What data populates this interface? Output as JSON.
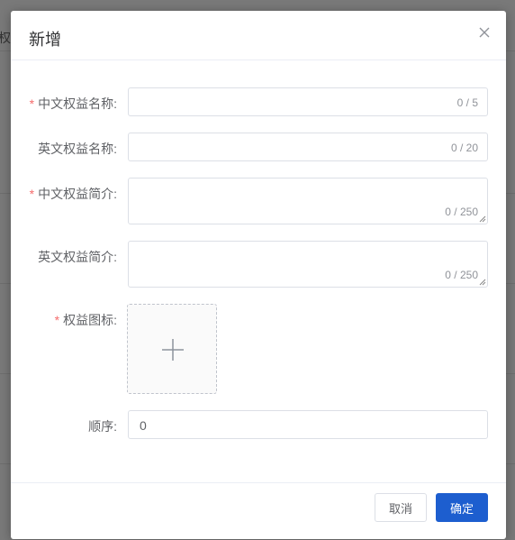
{
  "background": {
    "fragment_text": "权"
  },
  "dialog": {
    "title": "新增",
    "fields": {
      "cn_name": {
        "label": "中文权益名称:",
        "required": true,
        "counter": "0 / 5"
      },
      "en_name": {
        "label": "英文权益名称:",
        "required": false,
        "counter": "0 / 20"
      },
      "cn_intro": {
        "label": "中文权益简介:",
        "required": true,
        "counter": "0 / 250"
      },
      "en_intro": {
        "label": "英文权益简介:",
        "required": false,
        "counter": "0 / 250"
      },
      "icon": {
        "label": "权益图标:",
        "required": true
      },
      "order": {
        "label": "顺序:",
        "value": "0"
      }
    },
    "required_mark": "*",
    "footer": {
      "cancel_label": "取消",
      "ok_label": "确定"
    }
  },
  "colors": {
    "primary": "#1d5ecf",
    "required": "#f56c6c"
  }
}
